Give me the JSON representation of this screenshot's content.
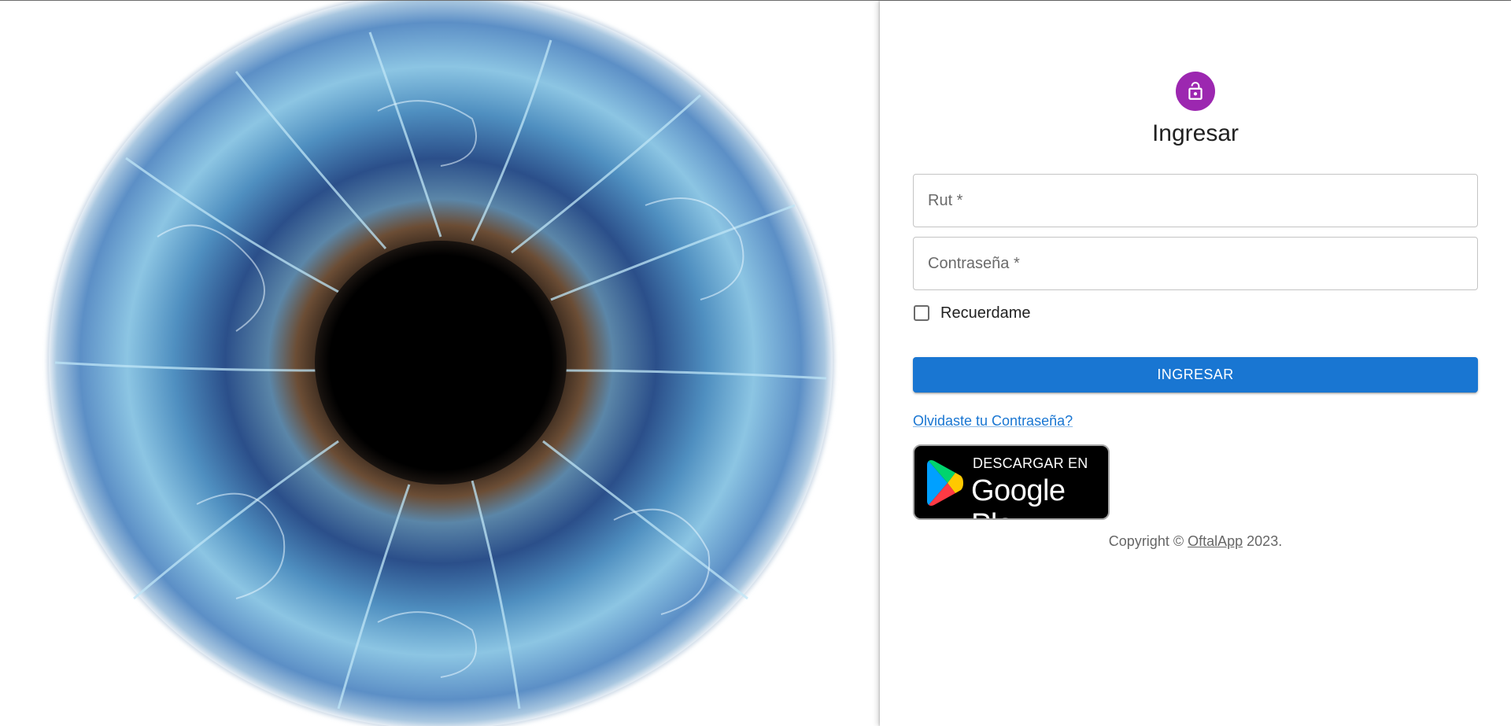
{
  "login": {
    "title": "Ingresar",
    "rut_placeholder": "Rut *",
    "password_placeholder": "Contraseña *",
    "remember_label": "Recuerdame",
    "submit_label": "INGRESAR",
    "forgot_label": "Olvidaste tu Contraseña?",
    "avatar_icon": "lock-open-icon",
    "avatar_color": "#9c27b0",
    "primary_color": "#1976d2"
  },
  "store_badge": {
    "small_text": "DESCARGAR EN",
    "big_text": "Google Play",
    "icon": "google-play-icon"
  },
  "footer": {
    "prefix": "Copyright © ",
    "brand": "OftalApp",
    "suffix": " 2023."
  },
  "hero": {
    "image": "blue-iris-closeup"
  }
}
